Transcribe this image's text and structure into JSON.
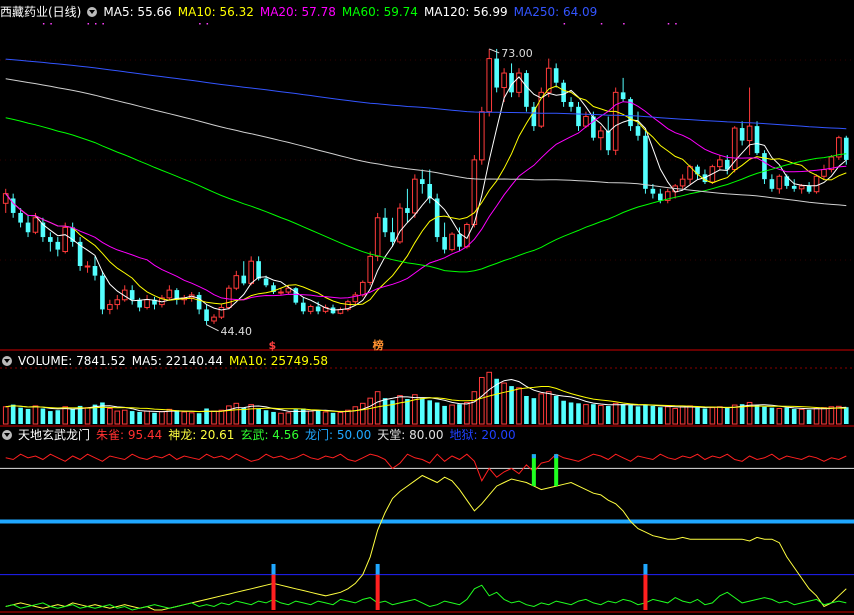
{
  "colors": {
    "up": "#ff3b3b",
    "down": "#54ffff",
    "ma5": "#ffffff",
    "ma10": "#ffff00",
    "ma20": "#ff00ff",
    "ma60": "#00ff00",
    "ma120": "#d0d0d0",
    "ma250": "#3355ff",
    "grid": "#8a0000",
    "zhuque": "#ff2020",
    "shenlong": "#ffff40",
    "xuanwu": "#20ff20",
    "longmen": "#20a8ff",
    "tiantang": "#e0e0e0",
    "diyu": "#2020ff"
  },
  "main": {
    "icon": "collapse-circle-icon",
    "title": "西藏药业(日线)",
    "ma_labels": [
      {
        "text": "MA5: 55.66",
        "color": "#ffffff"
      },
      {
        "text": "MA10: 56.32",
        "color": "#ffff00"
      },
      {
        "text": "MA20: 57.78",
        "color": "#ff00ff"
      },
      {
        "text": "MA60: 59.74",
        "color": "#00ff00"
      },
      {
        "text": "MA120: 56.99",
        "color": "#ffffff"
      },
      {
        "text": "MA250: 64.09",
        "color": "#3355ff"
      }
    ],
    "high_label": "73.00",
    "low_label": "44.40",
    "markers": [
      {
        "text": "$",
        "color": "#ff4040"
      },
      {
        "text": "榜",
        "color": "#ff9030"
      }
    ]
  },
  "volume": {
    "icon": "collapse-circle-icon",
    "labels": [
      {
        "text": "VOLUME: 7841.52",
        "color": "#ffffff"
      },
      {
        "text": "MA5: 22140.44",
        "color": "#ffffff"
      },
      {
        "text": "MA10: 25749.58",
        "color": "#ffff00"
      }
    ]
  },
  "indicator": {
    "icon": "collapse-circle-icon",
    "name": "天地玄武龙门",
    "labels": [
      {
        "text": "朱雀: 95.44",
        "color": "#ff3030"
      },
      {
        "text": "神龙: 20.61",
        "color": "#ffff40"
      },
      {
        "text": "玄武: 4.56",
        "color": "#30ff30"
      },
      {
        "text": "龙门: 50.00",
        "color": "#20a8ff"
      },
      {
        "text": "天堂: 80.00",
        "color": "#e0e0e0"
      },
      {
        "text": "地狱: 20.00",
        "color": "#2040ff"
      }
    ]
  },
  "chart_data": {
    "type": "candlestick",
    "price_range": [
      42,
      76
    ],
    "candles": [
      [
        57,
        58.5,
        56,
        58
      ],
      [
        57.5,
        58,
        55.5,
        56
      ],
      [
        56,
        56.5,
        54.5,
        55
      ],
      [
        55,
        55.8,
        53.5,
        54
      ],
      [
        54,
        56,
        53.8,
        55.5
      ],
      [
        55,
        55.5,
        53,
        53.5
      ],
      [
        53.5,
        54,
        52,
        53
      ],
      [
        53,
        53.5,
        51.5,
        52.2
      ],
      [
        52,
        55,
        51.8,
        54.5
      ],
      [
        54.5,
        55,
        52.5,
        53
      ],
      [
        53,
        53.5,
        50,
        50.5
      ],
      [
        50.5,
        51,
        49.8,
        50.5
      ],
      [
        50.5,
        51.5,
        49,
        49.5
      ],
      [
        49.5,
        50,
        45.5,
        46
      ],
      [
        46,
        47,
        45.5,
        46.5
      ],
      [
        46.5,
        47.5,
        46,
        47
      ],
      [
        47,
        48.5,
        46.8,
        48
      ],
      [
        48,
        48.5,
        46.5,
        47
      ],
      [
        47,
        47.2,
        45.8,
        46.2
      ],
      [
        46.2,
        47.5,
        46,
        47
      ],
      [
        47,
        47.3,
        46,
        46.5
      ],
      [
        46.5,
        47.5,
        46.2,
        47.2
      ],
      [
        47.2,
        48.5,
        47,
        48
      ],
      [
        48,
        48.2,
        46.5,
        47
      ],
      [
        47,
        47.5,
        46.5,
        47.2
      ],
      [
        47.2,
        47.8,
        46.8,
        47.5
      ],
      [
        47.5,
        47.8,
        45.5,
        46
      ],
      [
        46,
        46.5,
        44.4,
        44.8
      ],
      [
        44.8,
        45.5,
        44.5,
        45.2
      ],
      [
        45.2,
        46.5,
        45,
        46.2
      ],
      [
        46.2,
        48.5,
        46,
        48.2
      ],
      [
        48.2,
        50,
        48,
        49.5
      ],
      [
        49.5,
        51,
        48.5,
        48.7
      ],
      [
        48.7,
        51.5,
        48.5,
        51
      ],
      [
        51,
        51.5,
        49,
        49.2
      ],
      [
        49.2,
        49.5,
        48.3,
        48.5
      ],
      [
        48.5,
        48.8,
        47.6,
        47.8
      ],
      [
        47.8,
        48.2,
        47.5,
        47.8
      ],
      [
        47.8,
        48.5,
        47.6,
        48.2
      ],
      [
        48.2,
        48.3,
        46.5,
        46.7
      ],
      [
        46.7,
        47.2,
        45.5,
        45.8
      ],
      [
        45.8,
        46.5,
        45.5,
        46.3
      ],
      [
        46.3,
        46.8,
        45.5,
        45.8
      ],
      [
        45.8,
        46.5,
        45.6,
        46.2
      ],
      [
        46.2,
        46.5,
        45.5,
        45.6
      ],
      [
        45.6,
        46.2,
        45.5,
        46
      ],
      [
        46,
        47,
        45.8,
        46.8
      ],
      [
        46.8,
        47.8,
        46.5,
        47.5
      ],
      [
        47.5,
        49,
        47.3,
        48.8
      ],
      [
        48.8,
        52,
        48.5,
        51.5
      ],
      [
        51.5,
        56,
        51,
        55.5
      ],
      [
        55.5,
        56.5,
        53.5,
        54
      ],
      [
        54,
        55.5,
        52.5,
        53
      ],
      [
        53,
        57,
        52.8,
        56.5
      ],
      [
        56.5,
        58.5,
        55,
        56
      ],
      [
        56,
        60,
        55.5,
        59.5
      ],
      [
        59.5,
        60.5,
        58,
        59
      ],
      [
        59,
        60.5,
        57,
        57.5
      ],
      [
        57.5,
        58,
        53,
        53.5
      ],
      [
        53.5,
        55,
        51.8,
        52.2
      ],
      [
        52.2,
        54,
        52,
        53.8
      ],
      [
        53.8,
        54.5,
        52,
        52.5
      ],
      [
        52.5,
        55,
        52.3,
        54.8
      ],
      [
        54.8,
        62,
        54.5,
        61.5
      ],
      [
        61.5,
        67,
        61,
        66.5
      ],
      [
        66.5,
        73,
        66,
        72
      ],
      [
        72,
        73,
        68.5,
        69
      ],
      [
        69,
        71,
        67.5,
        70.5
      ],
      [
        70.5,
        71.5,
        68,
        68.5
      ],
      [
        68.5,
        71,
        68,
        70.5
      ],
      [
        70.5,
        70.8,
        66.5,
        67
      ],
      [
        67,
        67.5,
        64.5,
        65
      ],
      [
        65,
        69,
        64.8,
        68.5
      ],
      [
        68.5,
        72,
        68,
        71
      ],
      [
        71,
        71.5,
        69,
        69.5
      ],
      [
        69.5,
        69.8,
        67,
        67.5
      ],
      [
        67.5,
        68,
        66.5,
        67
      ],
      [
        67,
        67.5,
        64.5,
        65
      ],
      [
        65,
        66.5,
        64.8,
        66
      ],
      [
        66,
        66.5,
        63.5,
        63.8
      ],
      [
        63.8,
        65,
        62.5,
        64.5
      ],
      [
        64.5,
        66,
        62,
        62.5
      ],
      [
        62.5,
        69,
        62,
        68.5
      ],
      [
        68.5,
        70,
        67.5,
        67.8
      ],
      [
        67.8,
        68,
        64.5,
        65
      ],
      [
        65,
        66.5,
        63.5,
        64
      ],
      [
        64,
        64.5,
        58,
        58.5
      ],
      [
        58.5,
        59,
        57.5,
        58
      ],
      [
        58,
        58.5,
        57,
        57.3
      ],
      [
        57.3,
        58.5,
        57,
        58.2
      ],
      [
        58.2,
        59,
        57.5,
        58.8
      ],
      [
        58.8,
        60,
        58.5,
        59.5
      ],
      [
        59.5,
        61,
        59,
        60.8
      ],
      [
        60.8,
        61,
        59.5,
        60
      ],
      [
        60,
        60.5,
        59,
        59.2
      ],
      [
        59.2,
        61,
        59,
        60.8
      ],
      [
        60.8,
        62,
        60.5,
        61.5
      ],
      [
        61.5,
        62,
        60,
        60.5
      ],
      [
        60.5,
        65,
        60.2,
        64.8
      ],
      [
        64.8,
        65.5,
        63,
        63.5
      ],
      [
        63.5,
        69,
        62,
        65
      ],
      [
        65,
        65.5,
        62,
        62.2
      ],
      [
        62.2,
        62.5,
        59,
        59.5
      ],
      [
        59.5,
        60,
        58.2,
        58.5
      ],
      [
        58.5,
        60,
        58,
        59.8
      ],
      [
        59.8,
        60,
        58.5,
        58.8
      ],
      [
        58.8,
        59.5,
        58.2,
        58.5
      ],
      [
        58.5,
        59,
        58,
        58.8
      ],
      [
        58.8,
        59.2,
        58,
        58.2
      ],
      [
        58.2,
        60,
        58,
        59.8
      ],
      [
        59.8,
        61,
        59.5,
        60.5
      ],
      [
        60.5,
        62,
        60.2,
        61.8
      ],
      [
        61.8,
        64,
        61.5,
        63.8
      ],
      [
        63.8,
        64,
        61,
        61.5
      ]
    ],
    "volume": [
      4,
      4.5,
      3.8,
      3.5,
      4.2,
      3.6,
      3,
      3.2,
      4,
      3.5,
      4.2,
      3.8,
      4.5,
      5,
      3.6,
      3,
      3.2,
      3,
      2.8,
      3,
      2.6,
      2.9,
      3.4,
      3.2,
      2.8,
      2.6,
      2.5,
      3.6,
      3,
      3.2,
      4.2,
      4.8,
      3.8,
      4.5,
      3.6,
      3.2,
      2.8,
      2.5,
      2.6,
      3.4,
      3.6,
      3,
      3.2,
      2.8,
      2.6,
      2.7,
      3.2,
      4,
      4.8,
      6,
      7.5,
      6,
      5.5,
      6.6,
      5.8,
      6.8,
      6,
      5.5,
      5,
      4.2,
      4.4,
      4.6,
      5,
      7.5,
      10.8,
      12,
      10.5,
      9.5,
      8.8,
      8.4,
      6.5,
      6,
      7,
      7.5,
      6.5,
      5.4,
      5,
      4.8,
      4.5,
      4.6,
      4.3,
      4.2,
      4.8,
      4.6,
      4.4,
      4.1,
      4.4,
      4.2,
      3.9,
      4,
      3.6,
      4,
      4.2,
      3.8,
      3.6,
      3.8,
      4,
      3.7,
      4.4,
      4.6,
      5,
      4.4,
      4,
      3.8,
      3.6,
      3.8,
      3.5,
      3.4,
      3.3,
      3.6,
      3.8,
      4,
      4.1,
      3.9
    ],
    "volume_max": 13,
    "indicator": {
      "zhuque": [
        86,
        85,
        88,
        86,
        87,
        85,
        88,
        86,
        84,
        87,
        85,
        88,
        86,
        84,
        87,
        86,
        85,
        88,
        86,
        85,
        87,
        86,
        88,
        85,
        87,
        86,
        85,
        88,
        86,
        87,
        85,
        88,
        86,
        84,
        85,
        88,
        86,
        87,
        85,
        86,
        88,
        86,
        85,
        87,
        86,
        88,
        85,
        84,
        86,
        88,
        87,
        85,
        80,
        83,
        88,
        86,
        85,
        83,
        88,
        84,
        87,
        85,
        88,
        84,
        73,
        80,
        75,
        78,
        80,
        77,
        82,
        78,
        83,
        84,
        88,
        86,
        85,
        84,
        86,
        88,
        87,
        85,
        88,
        86,
        84,
        87,
        86,
        85,
        88,
        86,
        85,
        87,
        86,
        88,
        85,
        87,
        86,
        88,
        85,
        84,
        87,
        85,
        86,
        88,
        85,
        87,
        86,
        85,
        87,
        86,
        84,
        86,
        85,
        87
      ],
      "shenlong": [
        2,
        3,
        4,
        3,
        2,
        1,
        2,
        3,
        2,
        4,
        3,
        2,
        3,
        2,
        1,
        2,
        3,
        2,
        1,
        2,
        0,
        0,
        1,
        2,
        3,
        4,
        5,
        6,
        7,
        8,
        9,
        10,
        11,
        12,
        13,
        14,
        15,
        14,
        13,
        12,
        11,
        10,
        9,
        8,
        9,
        10,
        12,
        15,
        20,
        30,
        45,
        55,
        63,
        67,
        70,
        73,
        76,
        74,
        72,
        75,
        73,
        68,
        62,
        56,
        60,
        65,
        70,
        72,
        74,
        73,
        72,
        70,
        68,
        69,
        70,
        71,
        72,
        70,
        68,
        66,
        65,
        62,
        60,
        56,
        50,
        46,
        44,
        42,
        41,
        40,
        40,
        41,
        40,
        40,
        40,
        40,
        40,
        40,
        40,
        40,
        39,
        41,
        40,
        40,
        38,
        30,
        24,
        18,
        12,
        8,
        2,
        4,
        8,
        12
      ],
      "xuanwu": [
        2,
        3,
        1,
        2,
        3,
        4,
        2,
        1,
        2,
        3,
        1,
        2,
        1,
        2,
        3,
        1,
        2,
        0,
        1,
        2,
        3,
        2,
        1,
        2,
        3,
        4,
        2,
        3,
        2,
        4,
        3,
        5,
        4,
        3,
        5,
        4,
        6,
        4,
        3,
        5,
        4,
        3,
        5,
        4,
        3,
        6,
        5,
        4,
        6,
        7,
        4,
        5,
        3,
        4,
        5,
        6,
        4,
        2,
        3,
        5,
        4,
        3,
        6,
        12,
        14,
        8,
        10,
        6,
        4,
        5,
        3,
        2,
        4,
        3,
        5,
        4,
        3,
        5,
        6,
        4,
        3,
        5,
        4,
        6,
        5,
        3,
        4,
        6,
        5,
        4,
        7,
        5,
        4,
        6,
        3,
        4,
        8,
        10,
        7,
        4,
        5,
        6,
        7,
        6,
        4,
        5,
        3,
        4,
        5,
        6,
        3,
        4,
        5,
        4
      ],
      "buy_signals": [
        36,
        50,
        71,
        74,
        86
      ],
      "heaven": 80,
      "gate": 50,
      "hell": 20
    }
  }
}
